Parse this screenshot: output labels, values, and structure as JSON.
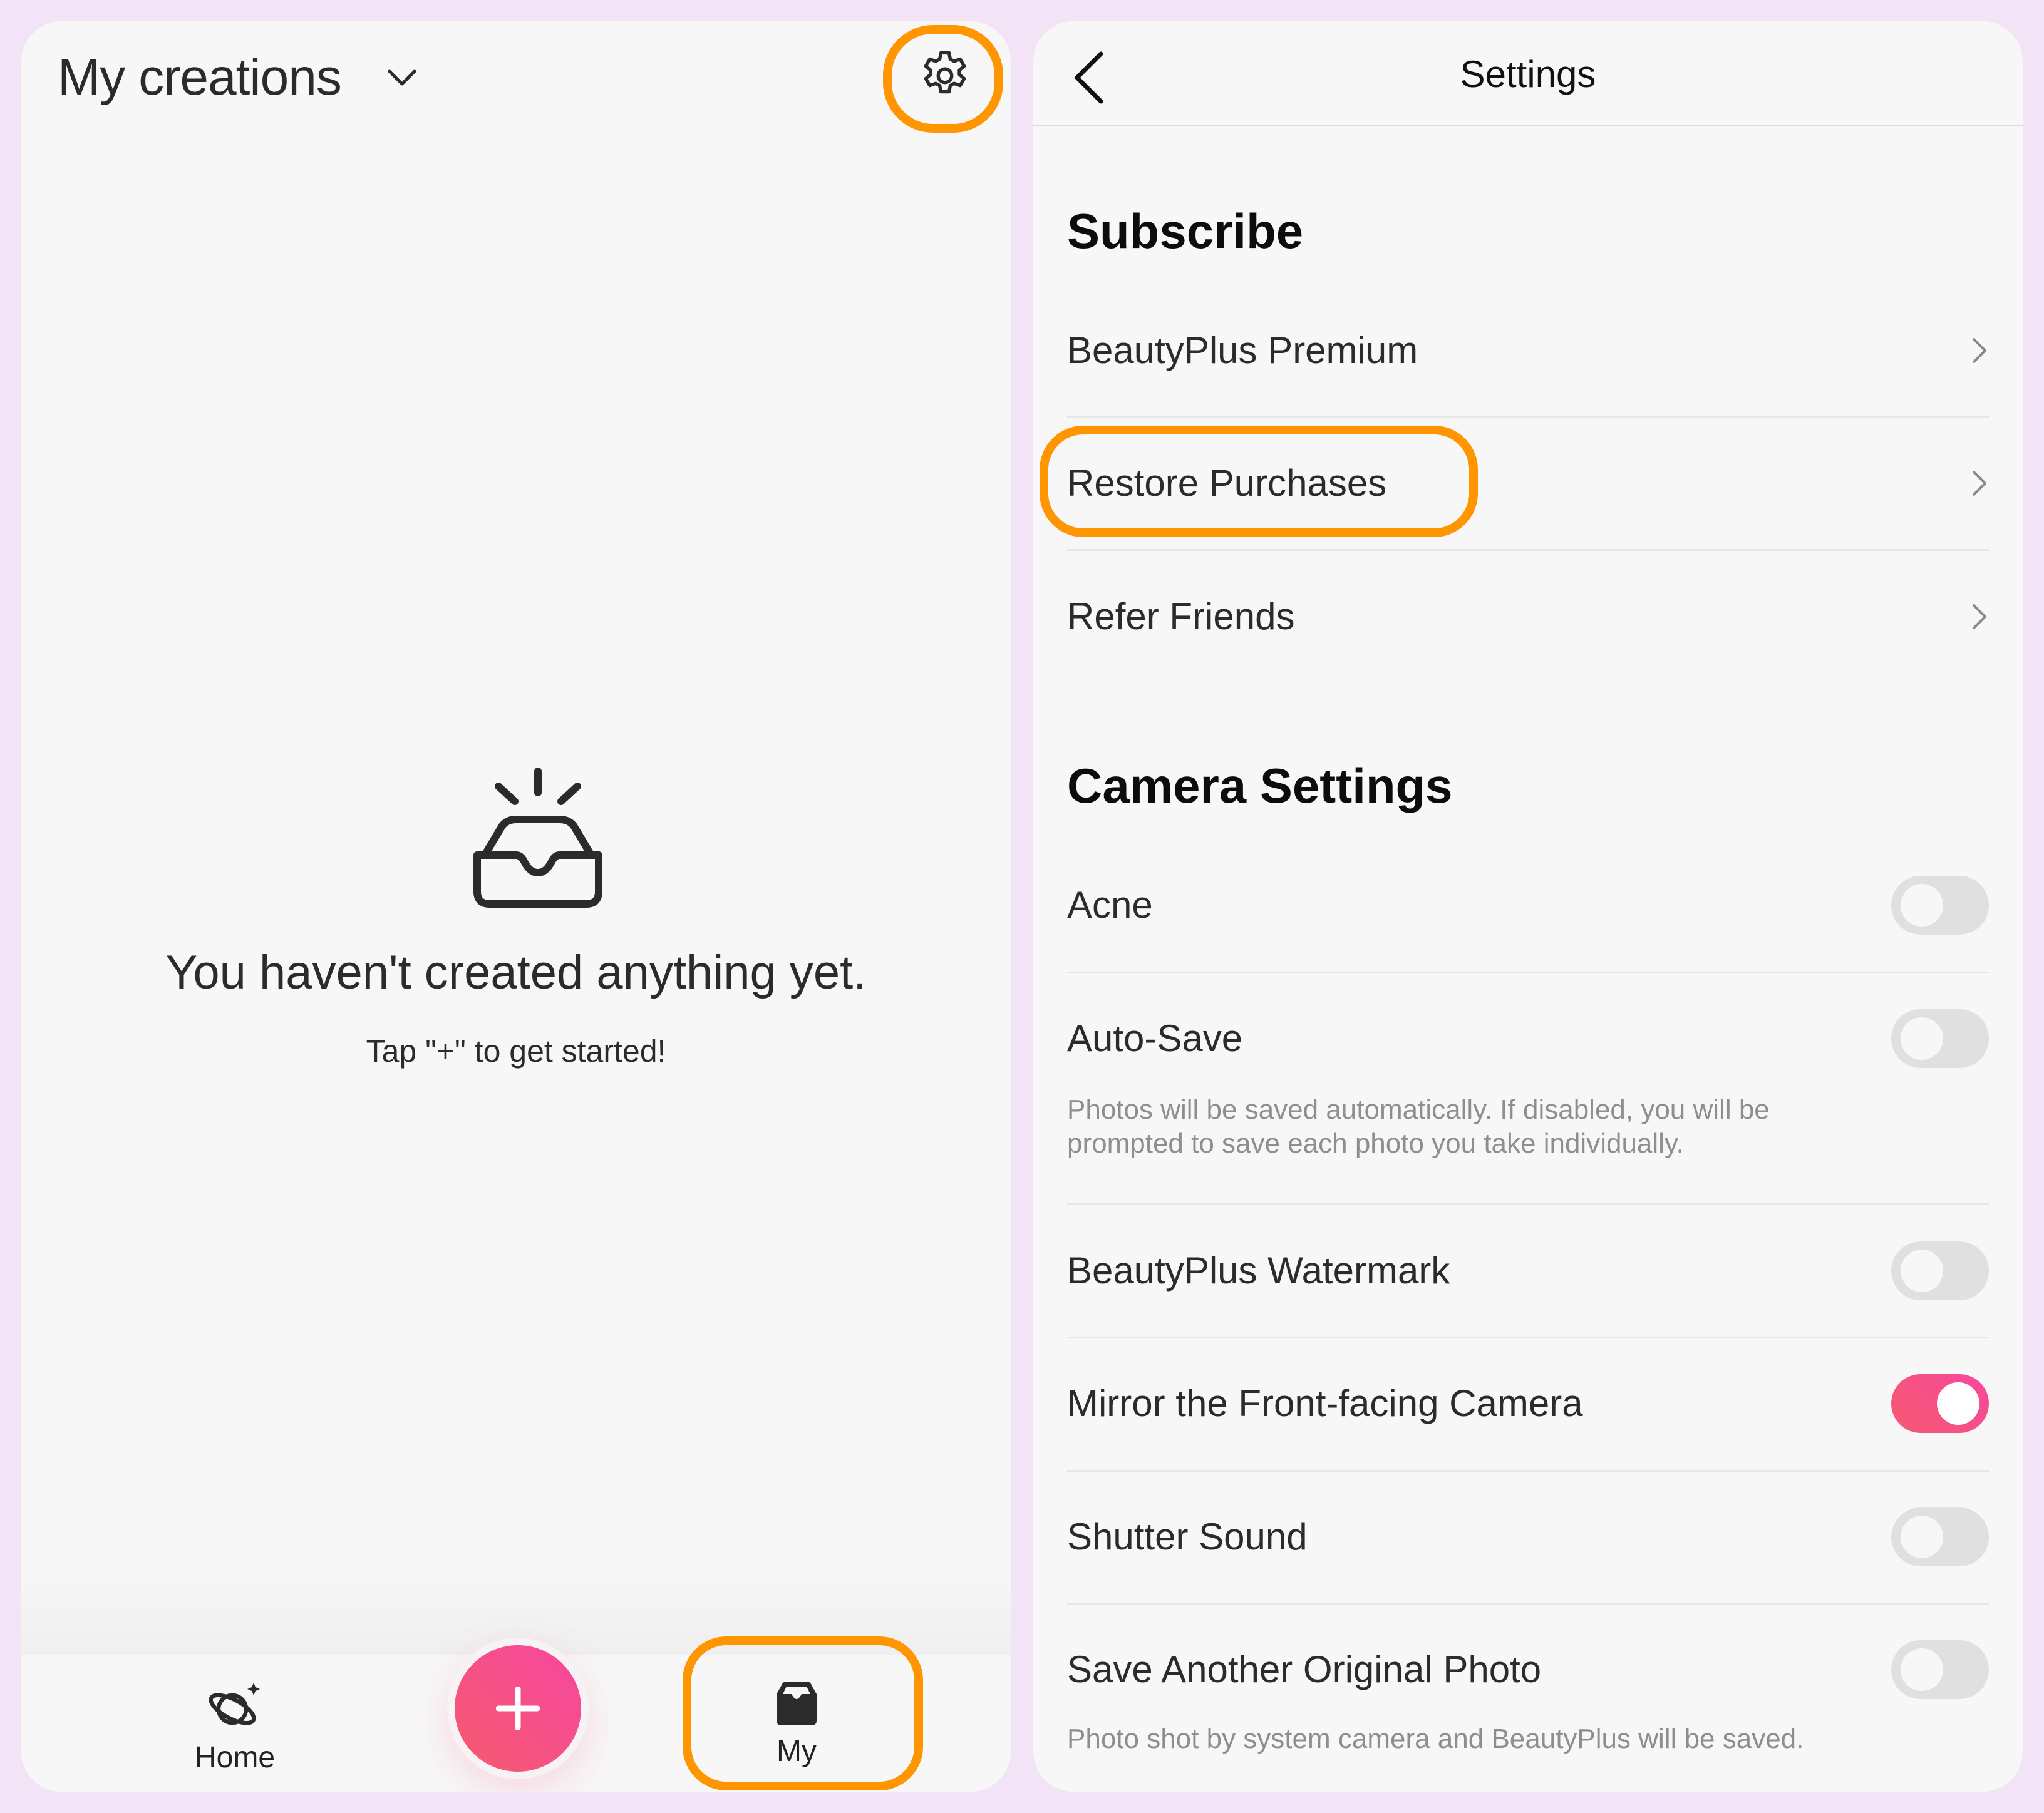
{
  "colors": {
    "background": "#f2e4f6",
    "panel": "#f7f7f7",
    "highlight": "#ff9500",
    "accent_start": "#f55a6e",
    "accent_end": "#f7479f",
    "toggle_off": "#e0e0e0"
  },
  "left_screen": {
    "header": {
      "title": "My creations",
      "title_icon": "chevron-down-icon",
      "settings_icon": "gear-icon"
    },
    "empty_state": {
      "icon": "empty-inbox-icon",
      "title": "You haven't created anything yet.",
      "subtitle": "Tap \"+\" to get started!"
    },
    "tab_bar": {
      "items": [
        {
          "label": "Home",
          "icon": "planet-icon",
          "active": false
        },
        {
          "label": "My",
          "icon": "inbox-tray-icon",
          "active": true
        }
      ],
      "create_button": {
        "label": "+",
        "icon": "plus-icon"
      }
    },
    "highlights": [
      "settings-gear",
      "tab-my"
    ]
  },
  "right_screen": {
    "header": {
      "title": "Settings",
      "back_icon": "chevron-left-icon"
    },
    "sections": [
      {
        "title": "Subscribe",
        "items": [
          {
            "label": "BeautyPlus Premium",
            "type": "link"
          },
          {
            "label": "Restore Purchases",
            "type": "link",
            "highlighted": true
          },
          {
            "label": "Refer Friends",
            "type": "link"
          }
        ]
      },
      {
        "title": "Camera Settings",
        "items": [
          {
            "label": "Acne",
            "type": "toggle",
            "on": false
          },
          {
            "label": "Auto-Save",
            "type": "toggle",
            "on": false,
            "description_lines": [
              "Photos will be saved automatically. If disabled, you will be",
              "prompted to save each photo you take individually."
            ]
          },
          {
            "label": "BeautyPlus Watermark",
            "type": "toggle",
            "on": false
          },
          {
            "label": "Mirror the Front-facing Camera",
            "type": "toggle",
            "on": true
          },
          {
            "label": "Shutter Sound",
            "type": "toggle",
            "on": false
          },
          {
            "label": "Save Another Original Photo",
            "type": "toggle",
            "on": false,
            "description_lines": [
              "Photo shot by system camera and BeautyPlus will be saved."
            ]
          }
        ]
      }
    ]
  }
}
